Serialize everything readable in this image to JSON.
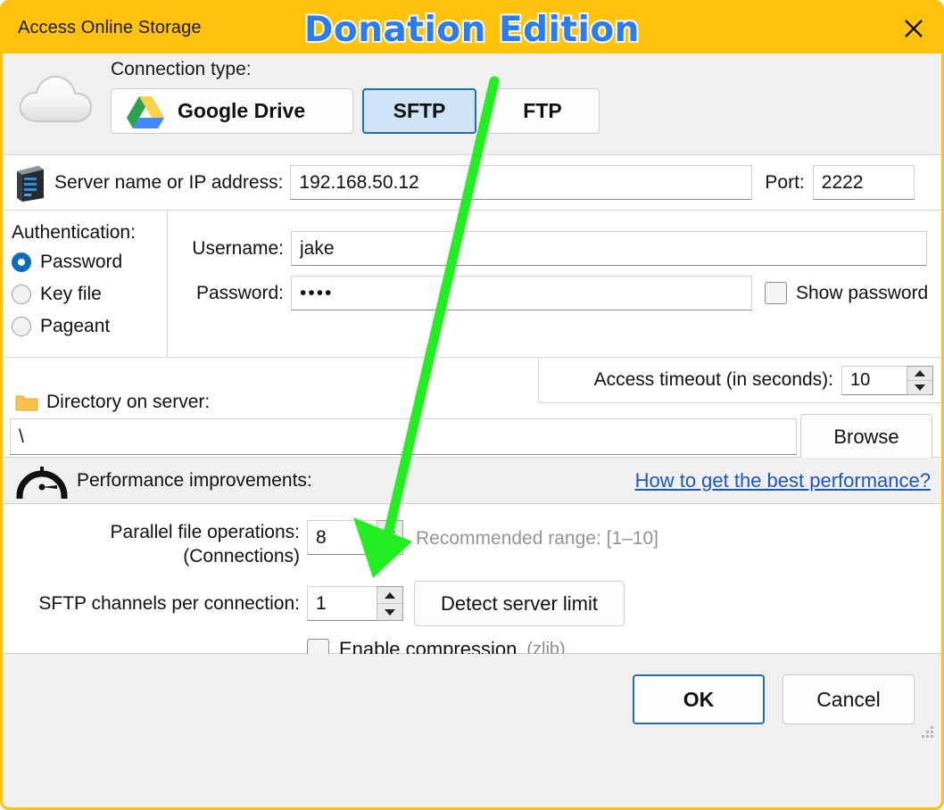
{
  "window": {
    "title": "Access Online Storage",
    "badge": "Donation Edition",
    "close_icon": "close-icon",
    "accent_color": "#ffc20e",
    "link_color": "#1a56c4",
    "arrow_color": "#22ee22"
  },
  "connection": {
    "label": "Connection type:",
    "cloud_icon": "cloud-icon",
    "options": [
      {
        "label": "Google Drive",
        "icon": "google-drive-icon",
        "selected": false
      },
      {
        "label": "SFTP",
        "selected": true
      },
      {
        "label": "FTP",
        "selected": false
      }
    ]
  },
  "server": {
    "icon": "server-rack-icon",
    "label": "Server name or IP address:",
    "value": "192.168.50.12",
    "placeholder": "",
    "port_label": "Port:",
    "port_value": "2222"
  },
  "auth": {
    "title": "Authentication:",
    "options": [
      {
        "label": "Password",
        "selected": true
      },
      {
        "label": "Key file",
        "selected": false
      },
      {
        "label": "Pageant",
        "selected": false
      }
    ],
    "username_label": "Username:",
    "username_value": "jake",
    "password_label": "Password:",
    "password_value": "••••",
    "show_password_label": "Show password",
    "show_password_checked": false
  },
  "directory": {
    "folder_icon": "folder-icon",
    "label": "Directory on server:",
    "value": "\\",
    "browse_label": "Browse",
    "timeout_label": "Access timeout (in seconds):",
    "timeout_value": "10"
  },
  "performance": {
    "gauge_icon": "speedometer-icon",
    "title": "Performance improvements:",
    "link": "How to get the best performance?",
    "parallel_label_line1": "Parallel file operations:",
    "parallel_label_line2": "(Connections)",
    "parallel_value": "8",
    "parallel_hint": "Recommended range: [1–10]",
    "channels_label": "SFTP channels per connection:",
    "channels_value": "1",
    "detect_label": "Detect server limit",
    "compression_label": "Enable compression",
    "compression_sub": "(zlib)",
    "compression_checked": false
  },
  "footer": {
    "ok_label": "OK",
    "cancel_label": "Cancel"
  }
}
